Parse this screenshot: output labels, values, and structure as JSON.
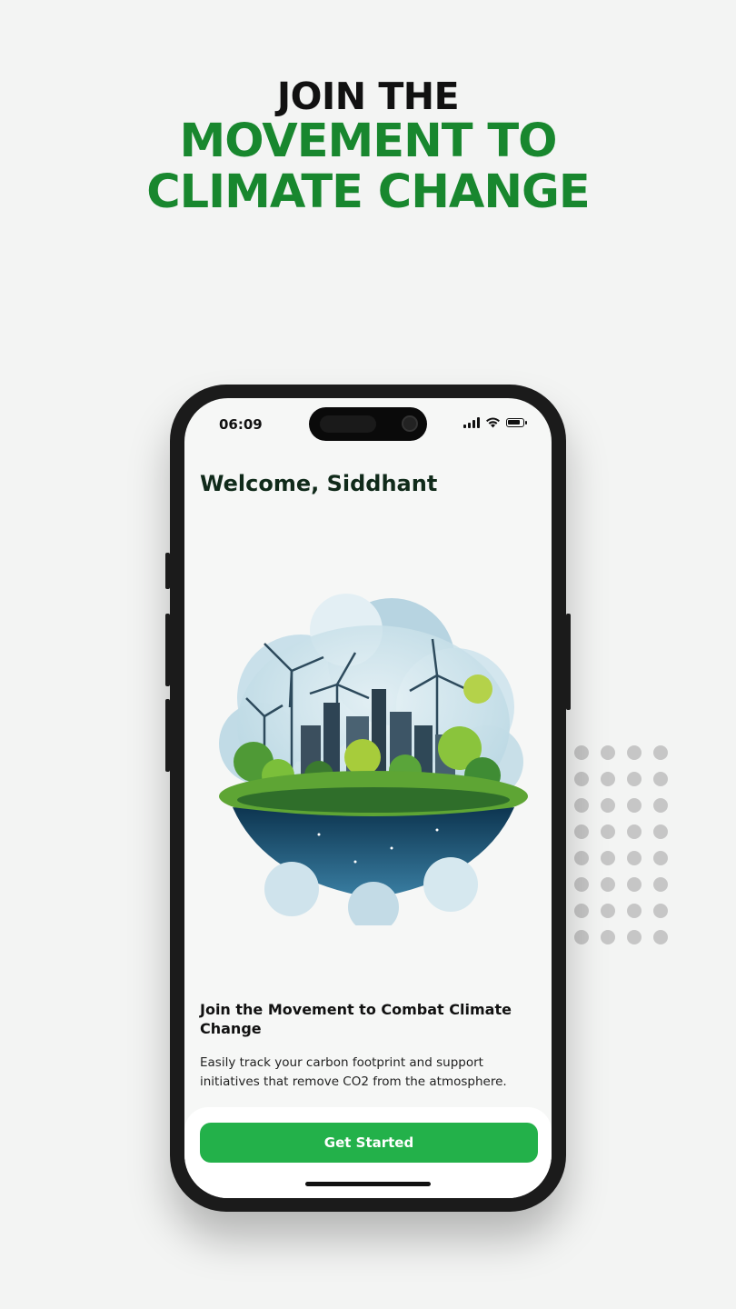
{
  "headline": {
    "line1": "JOIN THE",
    "line2": "MOVEMENT TO",
    "line3": "CLIMATE CHANGE"
  },
  "phone": {
    "status_bar": {
      "time": "06:09",
      "icons": [
        "signal-icon",
        "wifi-icon",
        "battery-icon"
      ]
    },
    "welcome_text": "Welcome, Siddhant",
    "illustration": "eco-city-wind-turbines-illustration",
    "content": {
      "title": "Join the Movement to Combat Climate Change",
      "description": "Easily track your carbon footprint and support initiatives that remove CO2 from the atmosphere."
    },
    "cta_label": "Get Started"
  },
  "colors": {
    "background": "#f3f4f3",
    "headline_dark": "#111111",
    "headline_green": "#18872e",
    "button_green": "#23b14a",
    "dots": "#c6c6c6"
  }
}
